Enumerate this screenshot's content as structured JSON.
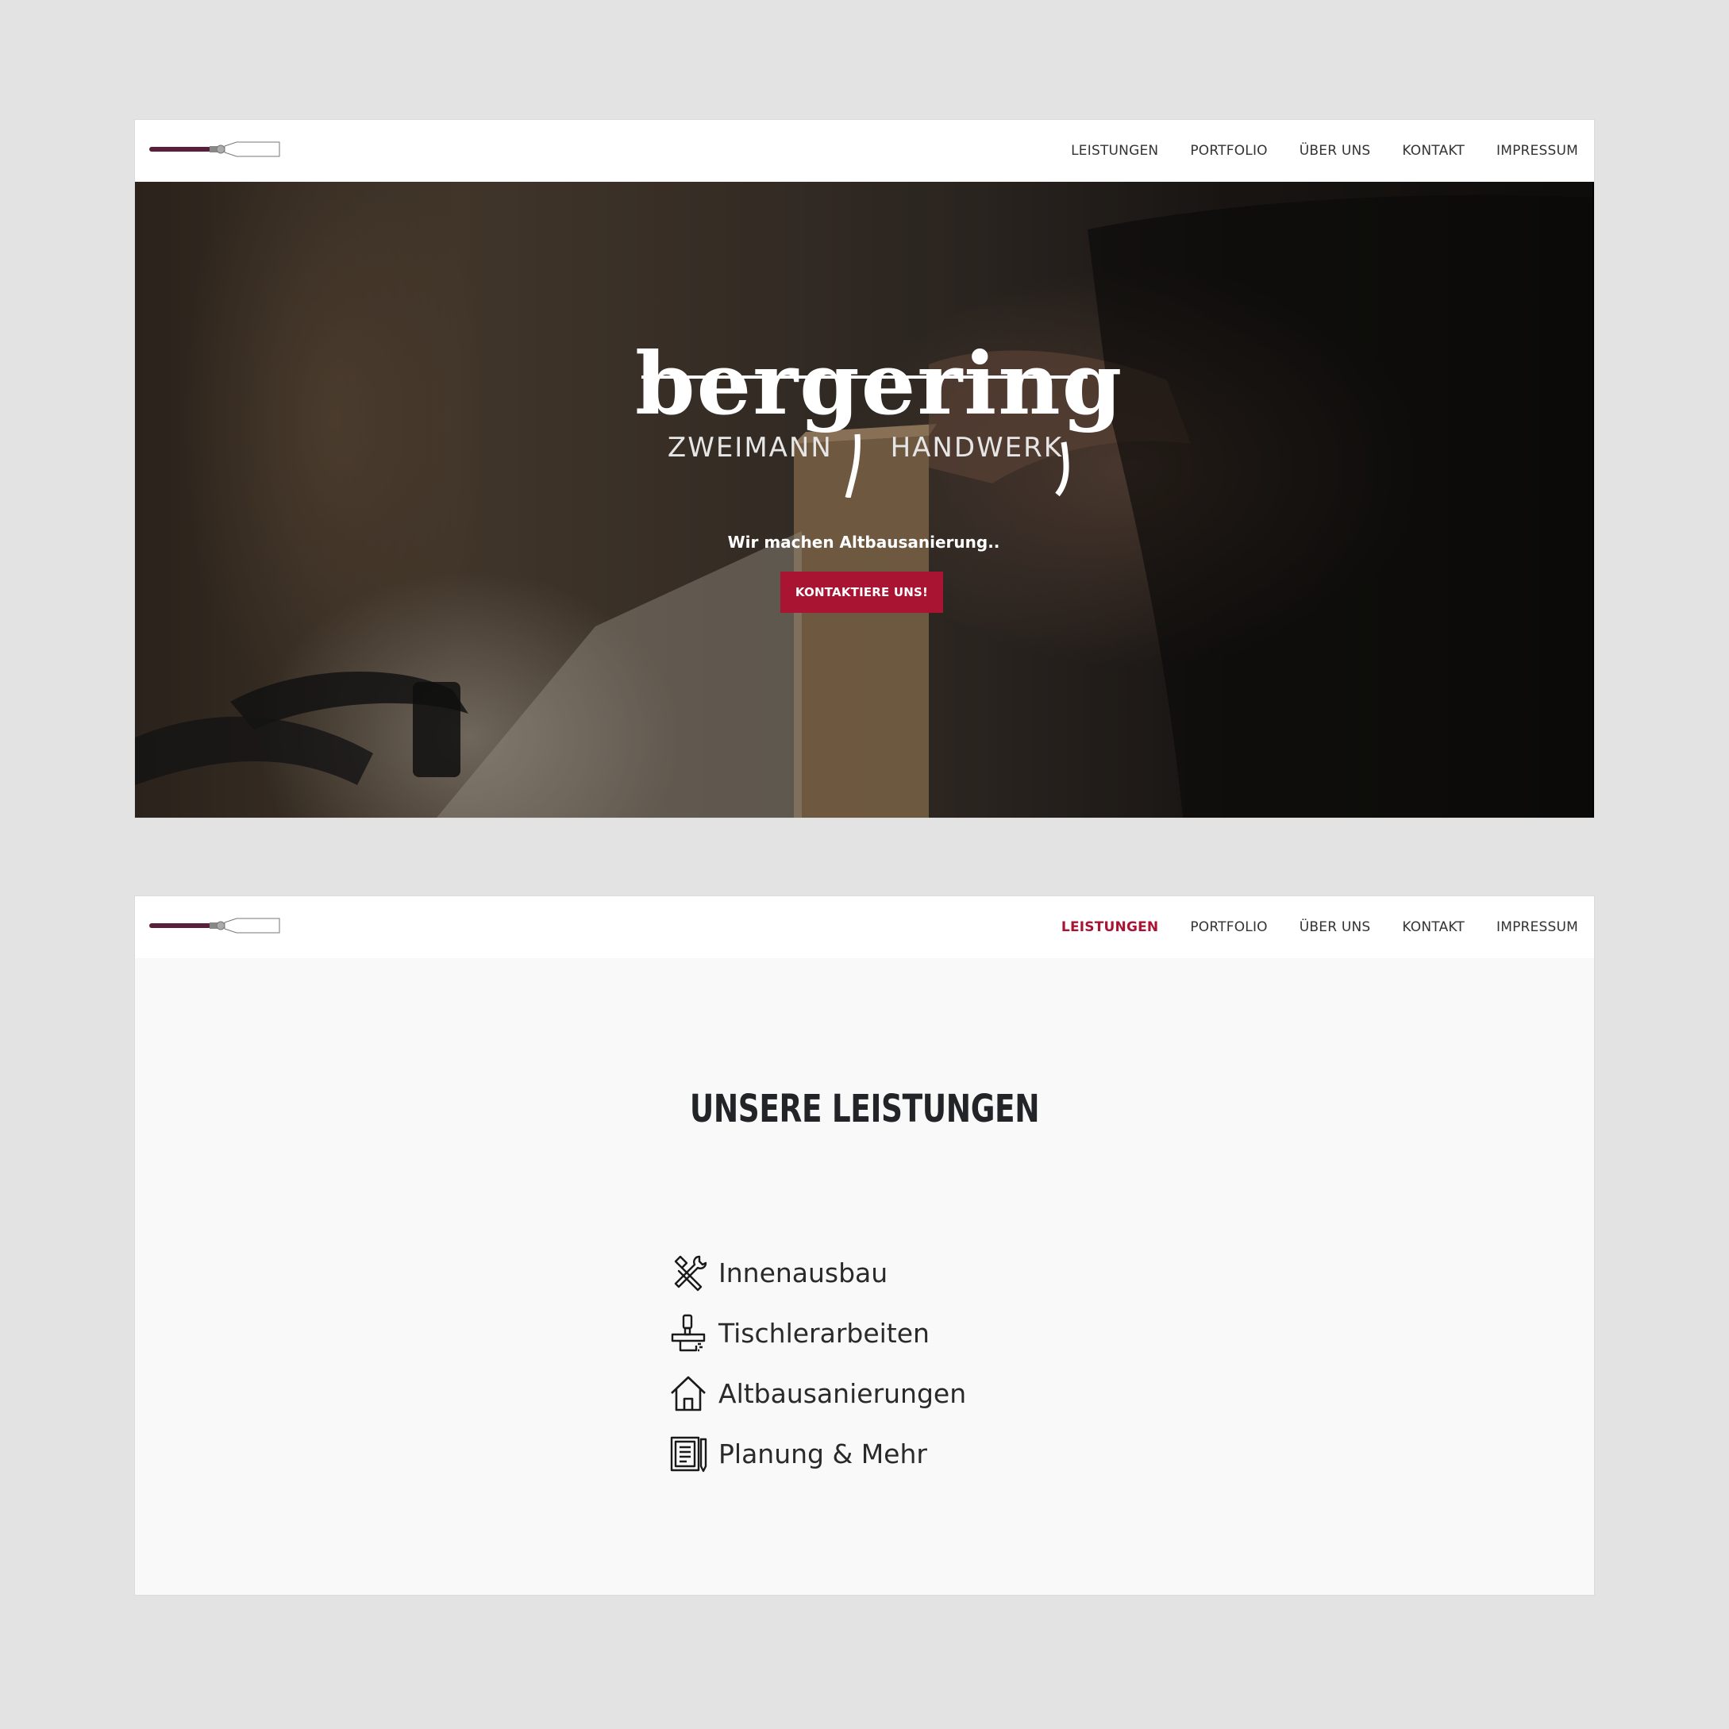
{
  "colors": {
    "page_background": "#e3e3e3",
    "accent": "#a81432",
    "nav_text": "#333333",
    "section_background": "#f9f9f9"
  },
  "screen1": {
    "nav": {
      "items": [
        {
          "label": "LEISTUNGEN",
          "active": false
        },
        {
          "label": "PORTFOLIO",
          "active": false
        },
        {
          "label": "ÜBER UNS",
          "active": false
        },
        {
          "label": "KONTAKT",
          "active": false
        },
        {
          "label": "IMPRESSUM",
          "active": false
        }
      ]
    },
    "hero": {
      "brand_name": "bergering",
      "brand_sub_left": "ZWEIMANN",
      "brand_sub_right": "HANDWERK",
      "tagline": "Wir machen Altbausanierung..",
      "cta_label": "KONTAKTIERE UNS!"
    }
  },
  "screen2": {
    "nav": {
      "items": [
        {
          "label": "LEISTUNGEN",
          "active": true
        },
        {
          "label": "PORTFOLIO",
          "active": false
        },
        {
          "label": "ÜBER UNS",
          "active": false
        },
        {
          "label": "KONTAKT",
          "active": false
        },
        {
          "label": "IMPRESSUM",
          "active": false
        }
      ]
    },
    "section": {
      "title": "UNSERE LEISTUNGEN",
      "services": [
        {
          "icon": "tools-icon",
          "label": "Innenausbau"
        },
        {
          "icon": "carpentry-icon",
          "label": "Tischlerarbeiten"
        },
        {
          "icon": "house-icon",
          "label": "Altbausanierungen"
        },
        {
          "icon": "blueprint-icon",
          "label": "Planung & Mehr"
        }
      ]
    }
  }
}
